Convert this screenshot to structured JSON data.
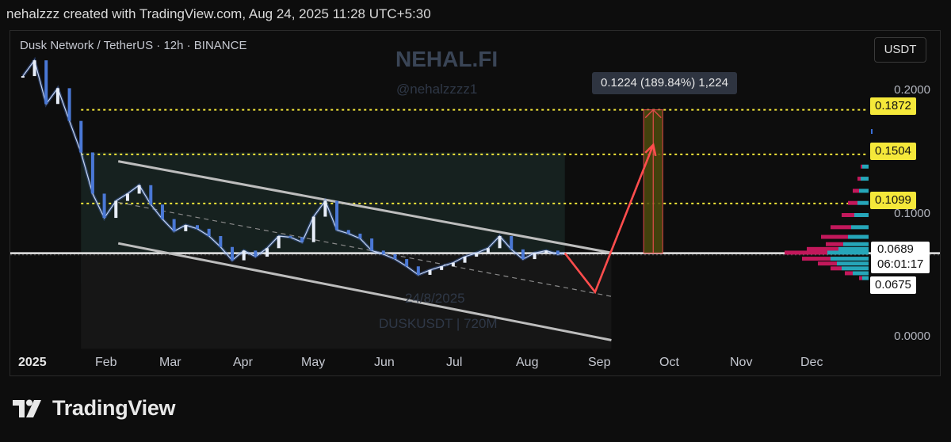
{
  "header": {
    "credit": "nehalzzz created with TradingView.com, Aug 24, 2025 11:28 UTC+5:30"
  },
  "chart_header": {
    "symbol_line": "Dusk Network / TetherUS · 12h · BINANCE"
  },
  "watermarks": {
    "brand": "NEHAL.FI",
    "handle": "@nehalzzzz1",
    "date": "24/8/2025",
    "ticker": "DUSKUSDT | 720M"
  },
  "currency_button": {
    "label": "USDT"
  },
  "measure_tooltip": {
    "text": "0.1224 (189.84%) 1,224"
  },
  "price_axis": {
    "labels": [
      "0.2000",
      "0.1000",
      "0.0000"
    ],
    "tags": {
      "target_high": "0.1872",
      "target_mid": "0.1504",
      "target_low": "0.1099",
      "current": "0.0689",
      "countdown": "06:01:17",
      "support": "0.0675"
    }
  },
  "time_axis": {
    "labels": [
      "2025",
      "Feb",
      "Mar",
      "Apr",
      "May",
      "Jun",
      "Jul",
      "Aug",
      "Sep",
      "Oct",
      "Nov",
      "Dec"
    ]
  },
  "footer": {
    "brand": "TradingView"
  },
  "colors": {
    "candle": "#4a78d6",
    "target_line": "#f5e83a",
    "arrow": "#ff4d4d",
    "channel": "#bdbdbd",
    "profile_up": "#26a6b9",
    "profile_down": "#c2185b"
  },
  "chart_data": {
    "type": "line",
    "title": "Dusk Network / TetherUS · 12h · BINANCE",
    "series": [
      {
        "name": "DUSKUSDT",
        "x": [
          "2025-01-03",
          "2025-01-08",
          "2025-01-13",
          "2025-01-18",
          "2025-01-23",
          "2025-01-28",
          "2025-02-02",
          "2025-02-07",
          "2025-02-12",
          "2025-02-17",
          "2025-02-22",
          "2025-02-27",
          "2025-03-04",
          "2025-03-09",
          "2025-03-14",
          "2025-03-19",
          "2025-03-24",
          "2025-03-29",
          "2025-04-03",
          "2025-04-08",
          "2025-04-13",
          "2025-04-18",
          "2025-04-23",
          "2025-04-28",
          "2025-05-03",
          "2025-05-08",
          "2025-05-13",
          "2025-05-18",
          "2025-05-23",
          "2025-05-28",
          "2025-06-02",
          "2025-06-07",
          "2025-06-12",
          "2025-06-17",
          "2025-06-22",
          "2025-06-27",
          "2025-07-02",
          "2025-07-07",
          "2025-07-12",
          "2025-07-17",
          "2025-07-22",
          "2025-07-27",
          "2025-08-01",
          "2025-08-06",
          "2025-08-11",
          "2025-08-16",
          "2025-08-21",
          "2025-08-24"
        ],
        "values": [
          0.215,
          0.228,
          0.192,
          0.205,
          0.178,
          0.152,
          0.118,
          0.098,
          0.112,
          0.118,
          0.125,
          0.109,
          0.097,
          0.087,
          0.092,
          0.089,
          0.083,
          0.074,
          0.063,
          0.071,
          0.066,
          0.073,
          0.083,
          0.082,
          0.078,
          0.099,
          0.112,
          0.088,
          0.085,
          0.081,
          0.071,
          0.068,
          0.064,
          0.058,
          0.051,
          0.055,
          0.058,
          0.061,
          0.066,
          0.069,
          0.073,
          0.083,
          0.072,
          0.064,
          0.069,
          0.071,
          0.068,
          0.0689
        ]
      }
    ],
    "ylim": [
      0.0,
      0.23
    ],
    "levels": [
      0.1872,
      0.1504,
      0.1099,
      0.0689,
      0.0675
    ],
    "projection": {
      "from": [
        "2025-08-24",
        0.0689
      ],
      "dip": [
        "2025-09-06",
        0.0368
      ],
      "to": [
        "2025-10-01",
        0.1872
      ]
    },
    "channel": {
      "upper": [
        [
          "2025-02-13",
          0.1447
        ],
        [
          "2025-09-13",
          0.0692
        ]
      ],
      "lower": [
        [
          "2025-02-13",
          0.077
        ],
        [
          "2025-09-13",
          -0.0029
        ]
      ]
    },
    "grid": false,
    "legend": "none"
  }
}
